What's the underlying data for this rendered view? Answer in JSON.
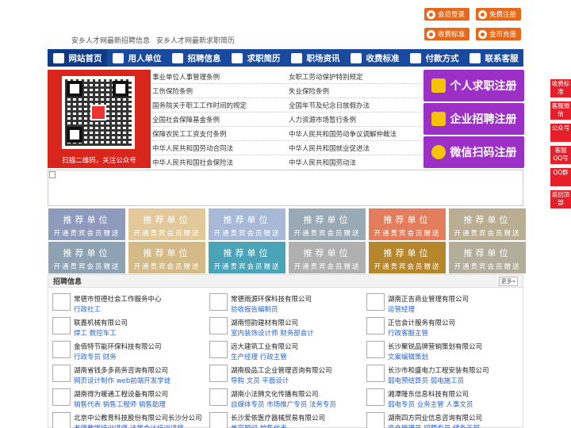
{
  "top_buttons": {
    "login": "会员登录",
    "signup": "免费注册",
    "fees": "收费标准",
    "recharge": "金币充值"
  },
  "site_links": [
    "安乡人才网最新招聘信息",
    "安乡人才网最新求职简历"
  ],
  "nav": [
    "网站首页",
    "用人单位",
    "招聘信息",
    "求职简历",
    "职场资讯",
    "收费标准",
    "付款方式",
    "联系客服"
  ],
  "qr_caption": "扫描二维码，关注公众号",
  "laws_left": [
    "事业单位人事管理条例",
    "工伤保险条例",
    "国务院关于职工工作时间的规定",
    "全国社会保障基金条例",
    "保障农民工工资支付条例",
    "中华人民共和国劳动合同法",
    "中华人民共和国社会保险法"
  ],
  "laws_right": [
    "女职工劳动保护特别规定",
    "失业保险条例",
    "全国年节及纪念日放假办法",
    "人力资源市场暂行条例",
    "中华人民共和国劳动争议调解仲裁法",
    "中华人民共和国就业促进法",
    "中华人民共和国劳动法"
  ],
  "register": {
    "resume": "个人求职注册",
    "company": "企业招聘注册",
    "wechat": "微信扫码注册"
  },
  "tiles": {
    "line1": "推荐单位",
    "line2": "开通贵宾会员赠送"
  },
  "tile_colors": [
    "#8f9bbd",
    "#e3c99a",
    "#a8b9d8",
    "#9aaab5",
    "#e47d5b",
    "#b9ae92",
    "#8fa2b3",
    "#d3ba86",
    "#4aa3b6",
    "#b0b0b0",
    "#b5862c",
    "#b3ad9b"
  ],
  "jobs_section": {
    "title": "招聘信息",
    "more": "更多»"
  },
  "jobs": [
    {
      "co": "常德市恒德社会工作服务中心",
      "pos": "行政社工"
    },
    {
      "co": "常德雨源环保科技有限公司",
      "pos": "验收报告编制员"
    },
    {
      "co": "湖南正吉商业管理有限公司",
      "pos": "运营经理"
    },
    {
      "co": "联嘉机械有限公司",
      "pos": "焊工 数控车工"
    },
    {
      "co": "湖南恒韵建材有限公司",
      "pos": "室内装饰设计师 财务部会计"
    },
    {
      "co": "正信会计服务有限公司",
      "pos": "行政客服主管"
    },
    {
      "co": "金佰特节能环保科技有限公司",
      "pos": "行政专员 财务"
    },
    {
      "co": "远大建筑工业有限公司",
      "pos": "生产经理 行政主管"
    },
    {
      "co": "长沙聚锐品牌营销策划有限公司",
      "pos": "文案编辑策划"
    },
    {
      "co": "湖南省钱多多商务咨询有限公司",
      "pos": "网页设计制作 web前端开发学徒"
    },
    {
      "co": "湖南极品工企业管理咨询有限公司",
      "pos": "导购 文员 平面设计"
    },
    {
      "co": "长沙市和盛电力工程安装有限公司",
      "pos": "弱电预结算员 弱电施工员"
    },
    {
      "co": "湖南得为暖通工程设备有限公司",
      "pos": "销售代表 销售工程师 销售助理"
    },
    {
      "co": "湖南小法狮文化传播有限公司",
      "pos": "自媒体专员 市场推广专员 法务专员"
    },
    {
      "co": "湘潭隆东信息科技有限公司",
      "pos": "弱电专员 业务主管 人事文员"
    },
    {
      "co": "北京中公教育科技股份有限公司长沙分公司",
      "pos": "老师教学培训讲师 法学会计培训讲师"
    },
    {
      "co": "长沙爱依医疗器械贸易有限公司",
      "pos": "美容顾问 销售代表"
    },
    {
      "co": "湖南四方同业信息咨询有限公司",
      "pos": "资产管理员 招聘专员 储备干部"
    }
  ],
  "side_tabs": [
    "收费标准",
    "客服微信",
    "公众号",
    "客服QQ号",
    "QQ群",
    "返回顶部"
  ]
}
